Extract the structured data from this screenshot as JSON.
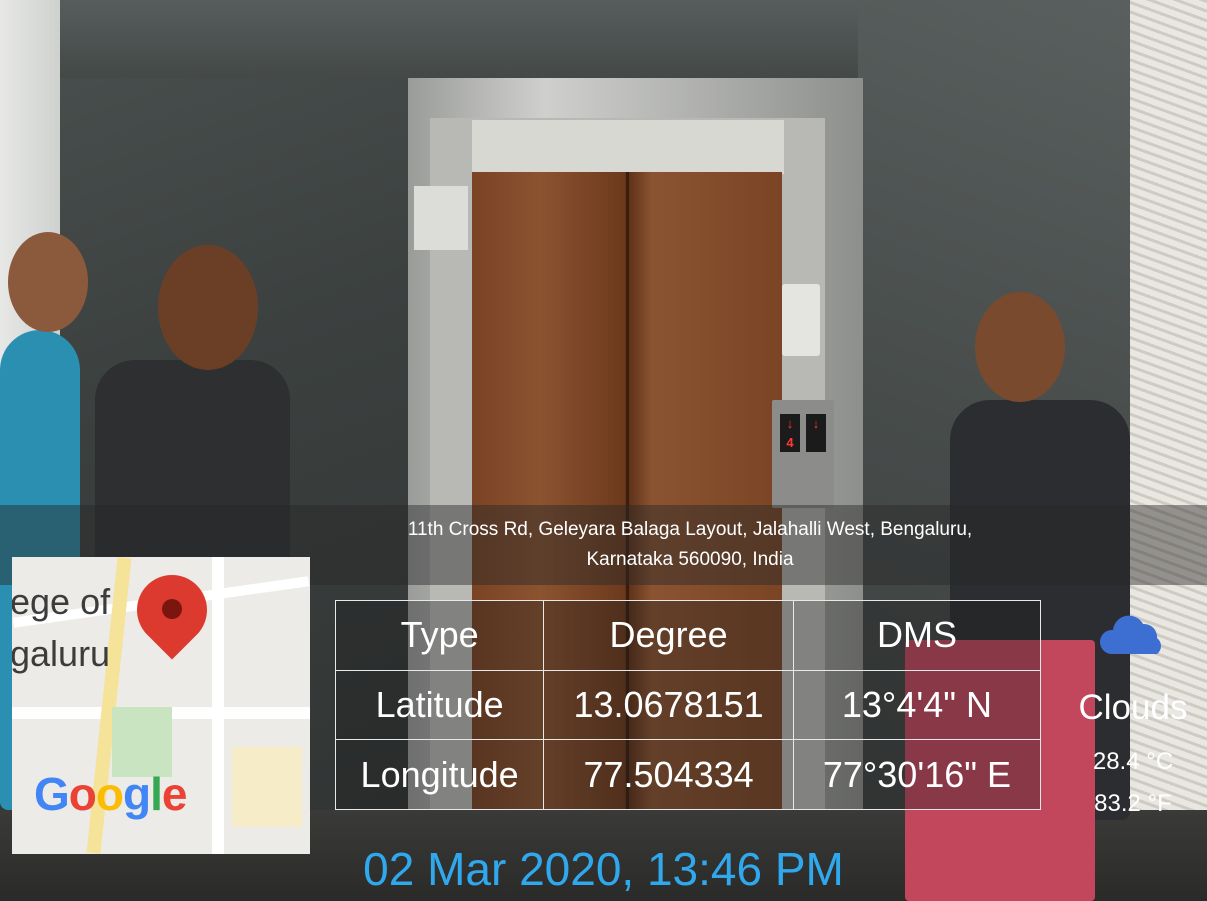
{
  "address": {
    "line1": "11th Cross Rd, Geleyara Balaga Layout, Jalahalli West, Bengaluru,",
    "line2": "Karnataka 560090, India"
  },
  "map": {
    "label_line1": "ege of",
    "label_line2": "galuru",
    "brand": "Google",
    "pin_color": "#dd3a2f"
  },
  "coordinates": {
    "headers": [
      "Type",
      "Degree",
      "DMS"
    ],
    "rows": [
      [
        "Latitude",
        "13.0678151",
        "13°4'4\" N"
      ],
      [
        "Longitude",
        "77.504334",
        "77°30'16\" E"
      ]
    ]
  },
  "weather": {
    "icon": "cloud-icon",
    "condition": "Clouds",
    "temp_c": "28.4 °C",
    "temp_f": "83.2 °F"
  },
  "datetime": "02 Mar 2020, 13:46 PM",
  "elevator_display": {
    "floor": "4"
  },
  "colors": {
    "datetime": "#2fa8ee",
    "cloud": "#3c6fd1"
  }
}
